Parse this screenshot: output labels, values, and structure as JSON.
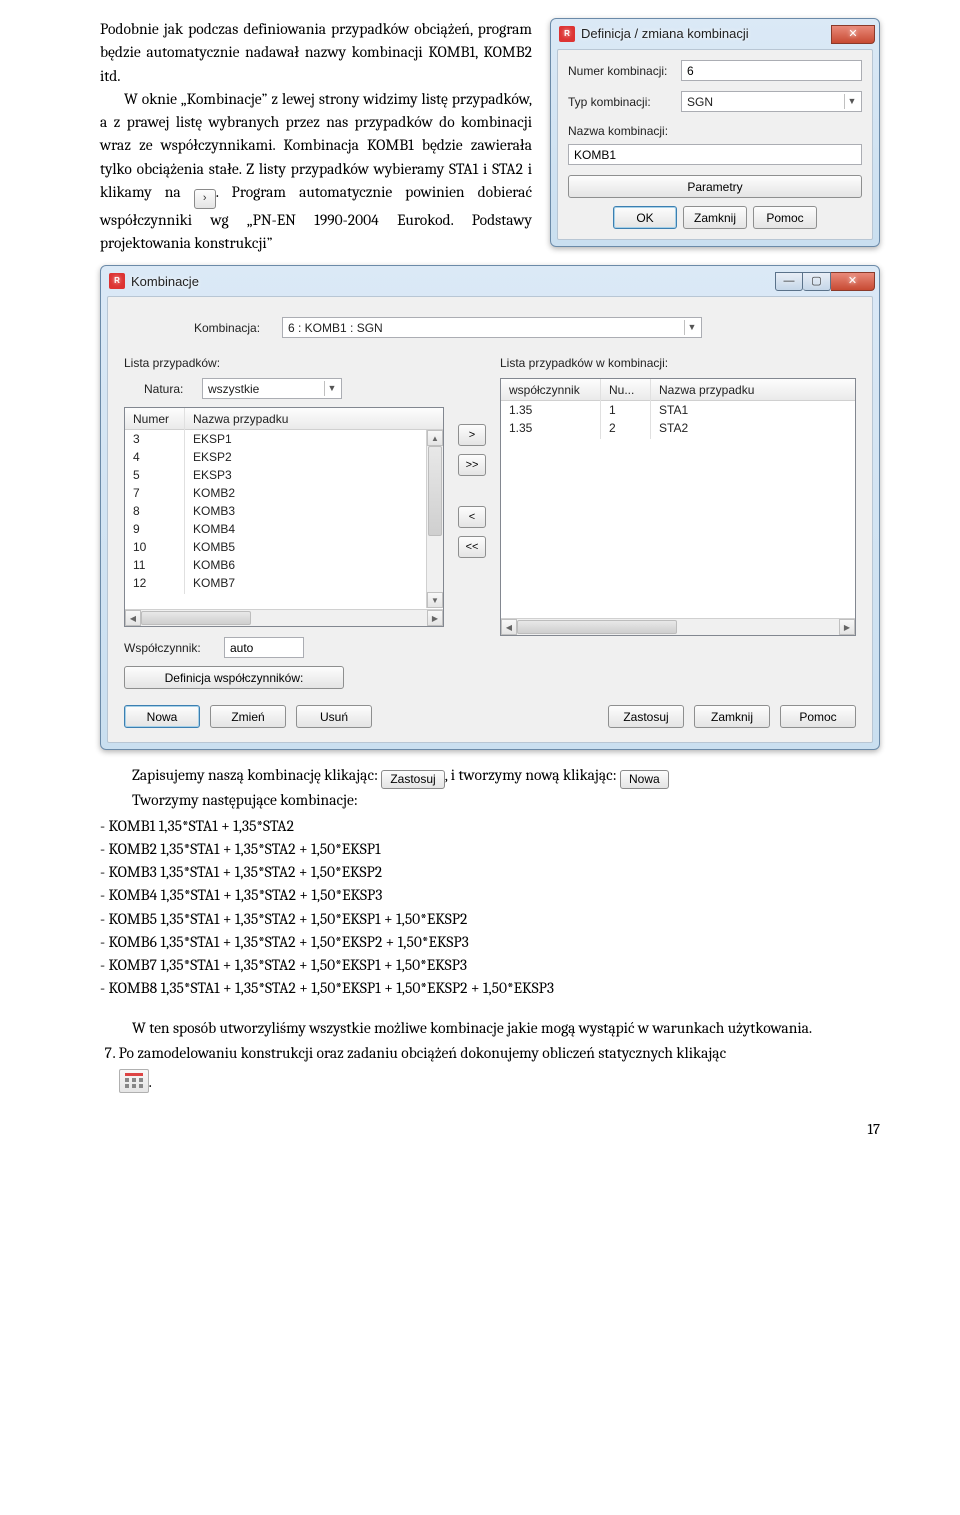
{
  "p1": {
    "t1": "Podobnie jak podczas definiowania przypadków obciążeń, program będzie automatycznie nadawał nazwy kombinacji KOMB1, KOMB2 itd.",
    "t2a": "W oknie „Kombinacje” z lewej strony widzimy listę przypadków, a z prawej listę wybranych przez nas przypadków do kombinacji wraz ze współczynnikami. Kombinacja KOMB1 będzie zawierała tylko obciążenia stałe. Z listy przypadków wybieramy STA1 i STA2 i klikamy na ",
    "t2b": ". Program automatycznie powinien dobierać współczynniki wg „PN-EN 1990-2004 Eurokod. Podstawy projektowania konstrukcji”"
  },
  "dlg1": {
    "title": "Definicja / zmiana kombinacji",
    "l_num": "Numer kombinacji:",
    "v_num": "6",
    "l_typ": "Typ kombinacji:",
    "v_typ": "SGN",
    "l_naz": "Nazwa kombinacji:",
    "v_naz": "KOMB1",
    "b_par": "Parametry",
    "b_ok": "OK",
    "b_close": "Zamknij",
    "b_help": "Pomoc"
  },
  "dlg2": {
    "title": "Kombinacje",
    "l_komb": "Kombinacja:",
    "v_komb": "6 : KOMB1 : SGN",
    "l_left": "Lista przypadków:",
    "l_nat": "Natura:",
    "v_nat": "wszystkie",
    "c_num": "Numer",
    "c_name": "Nazwa przypadku",
    "rowsL": [
      {
        "n": "3",
        "name": "EKSP1"
      },
      {
        "n": "4",
        "name": "EKSP2"
      },
      {
        "n": "5",
        "name": "EKSP3"
      },
      {
        "n": "7",
        "name": "KOMB2"
      },
      {
        "n": "8",
        "name": "KOMB3"
      },
      {
        "n": "9",
        "name": "KOMB4"
      },
      {
        "n": "10",
        "name": "KOMB5"
      },
      {
        "n": "11",
        "name": "KOMB6"
      },
      {
        "n": "12",
        "name": "KOMB7"
      }
    ],
    "l_right": "Lista przypadków w kombinacji:",
    "c_w": "współczynnik",
    "c_nu": "Nu...",
    "c_np": "Nazwa przypadku",
    "rowsR": [
      {
        "w": "1.35",
        "n": "1",
        "name": "STA1"
      },
      {
        "w": "1.35",
        "n": "2",
        "name": "STA2"
      }
    ],
    "b_r": ">",
    "b_rr": ">>",
    "b_l": "<",
    "b_ll": "<<",
    "l_wsp": "Współczynnik:",
    "v_wsp": "auto",
    "b_def": "Definicja współczynników:",
    "b_new": "Nowa",
    "b_mod": "Zmień",
    "b_del": "Usuń",
    "b_apply": "Zastosuj",
    "b_close": "Zamknij",
    "b_help": "Pomoc"
  },
  "after": {
    "line1a": "Zapisujemy naszą kombinację klikając: ",
    "line1b": ", i tworzymy nową klikając: ",
    "btn_apply": "Zastosuj",
    "btn_new": "Nowa",
    "line2": "Tworzymy następujące kombinacje:",
    "k": [
      "- KOMB1 1,35*STA1 + 1,35*STA2",
      "- KOMB2 1,35*STA1 + 1,35*STA2 + 1,50*EKSP1",
      "- KOMB3 1,35*STA1 + 1,35*STA2 + 1,50*EKSP2",
      "- KOMB4 1,35*STA1 + 1,35*STA2 + 1,50*EKSP3",
      "- KOMB5 1,35*STA1 + 1,35*STA2 + 1,50*EKSP1 + 1,50*EKSP2",
      "- KOMB6 1,35*STA1 + 1,35*STA2 + 1,50*EKSP2 + 1,50*EKSP3",
      "- KOMB7 1,35*STA1 + 1,35*STA2 + 1,50*EKSP1 + 1,50*EKSP3",
      "- KOMB8 1,35*STA1 + 1,35*STA2 + 1,50*EKSP1 + 1,50*EKSP2 + 1,50*EKSP3"
    ],
    "p3": "W ten sposób utworzyliśmy wszystkie możliwe kombinacje jakie mogą wystąpić w warunkach użytkowania.",
    "li7a": "Po zamodelowaniu konstrukcji oraz zadaniu obciążeń dokonujemy obliczeń statycznych klikając ",
    "li7b": "."
  },
  "page": "17"
}
